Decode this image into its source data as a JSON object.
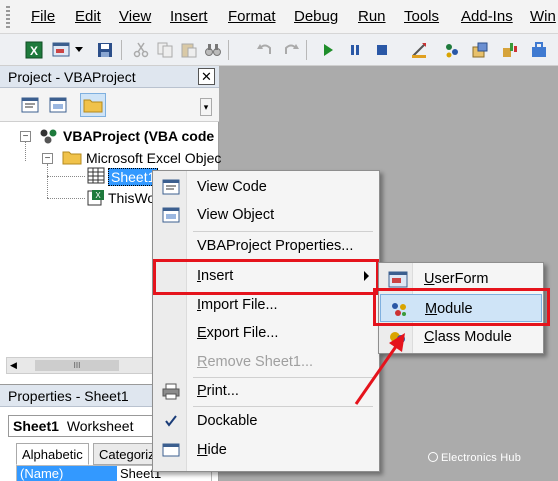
{
  "menubar": {
    "items": [
      "File",
      "Edit",
      "View",
      "Insert",
      "Format",
      "Debug",
      "Run",
      "Tools",
      "Add-Ins",
      "Win"
    ]
  },
  "toolbar": {
    "icons": [
      "excel-icon",
      "insert-userform-icon",
      "dropdown-icon",
      "save-icon",
      "cut-icon",
      "copy-icon",
      "paste-icon",
      "find-icon",
      "undo-icon",
      "redo-icon",
      "run-icon",
      "break-icon",
      "reset-icon",
      "design-mode-icon",
      "project-explorer-icon",
      "properties-icon",
      "object-browser-icon"
    ]
  },
  "project_pane": {
    "title": "Project - VBAProject",
    "close": "✕",
    "tree": {
      "root": "VBAProject (VBA code",
      "folder": "Microsoft Excel Objec",
      "sheet": "Sheet1",
      "workbook": "ThisWo"
    },
    "scroll_glyph": "III"
  },
  "properties_pane": {
    "title": "Properties - Sheet1",
    "object_name": "Sheet1",
    "object_type": "Worksheet",
    "tabs": [
      "Alphabetic",
      "Categoriz"
    ],
    "row_name": "(Name)",
    "row_value": "Sheet1"
  },
  "context_menu": {
    "items": [
      {
        "label": "View Code",
        "acc": "View C",
        "rest": "ode"
      },
      {
        "label": "View Object",
        "acc": "View O",
        "rest": "bject"
      },
      {
        "label": "VBAProject Properties...",
        "acc": "",
        "rest": ""
      },
      {
        "label": "Insert",
        "acc": "I",
        "rest": "nsert"
      },
      {
        "label": "Import File...",
        "acc": "I",
        "rest": "mport File..."
      },
      {
        "label": "Export File...",
        "acc": "E",
        "rest": "xport File..."
      },
      {
        "label": "Remove Sheet1...",
        "acc": "R",
        "rest": "emove Sheet1..."
      },
      {
        "label": "Print...",
        "acc": "P",
        "rest": "rint..."
      },
      {
        "label": "Dockable",
        "acc": "",
        "rest": ""
      },
      {
        "label": "Hide",
        "acc": "H",
        "rest": "ide"
      }
    ]
  },
  "insert_submenu": {
    "items": [
      {
        "label": "UserForm",
        "acc": "U",
        "rest": "serForm"
      },
      {
        "label": "Module",
        "acc": "M",
        "rest": "odule"
      },
      {
        "label": "Class Module",
        "acc": "C",
        "rest": "lass Module"
      }
    ]
  },
  "watermark": {
    "text": "Electronics Hub"
  },
  "colors": {
    "highlight_red": "#e5131c",
    "selection_blue": "#3399ff",
    "module_highlight": "#cfe4f7"
  }
}
